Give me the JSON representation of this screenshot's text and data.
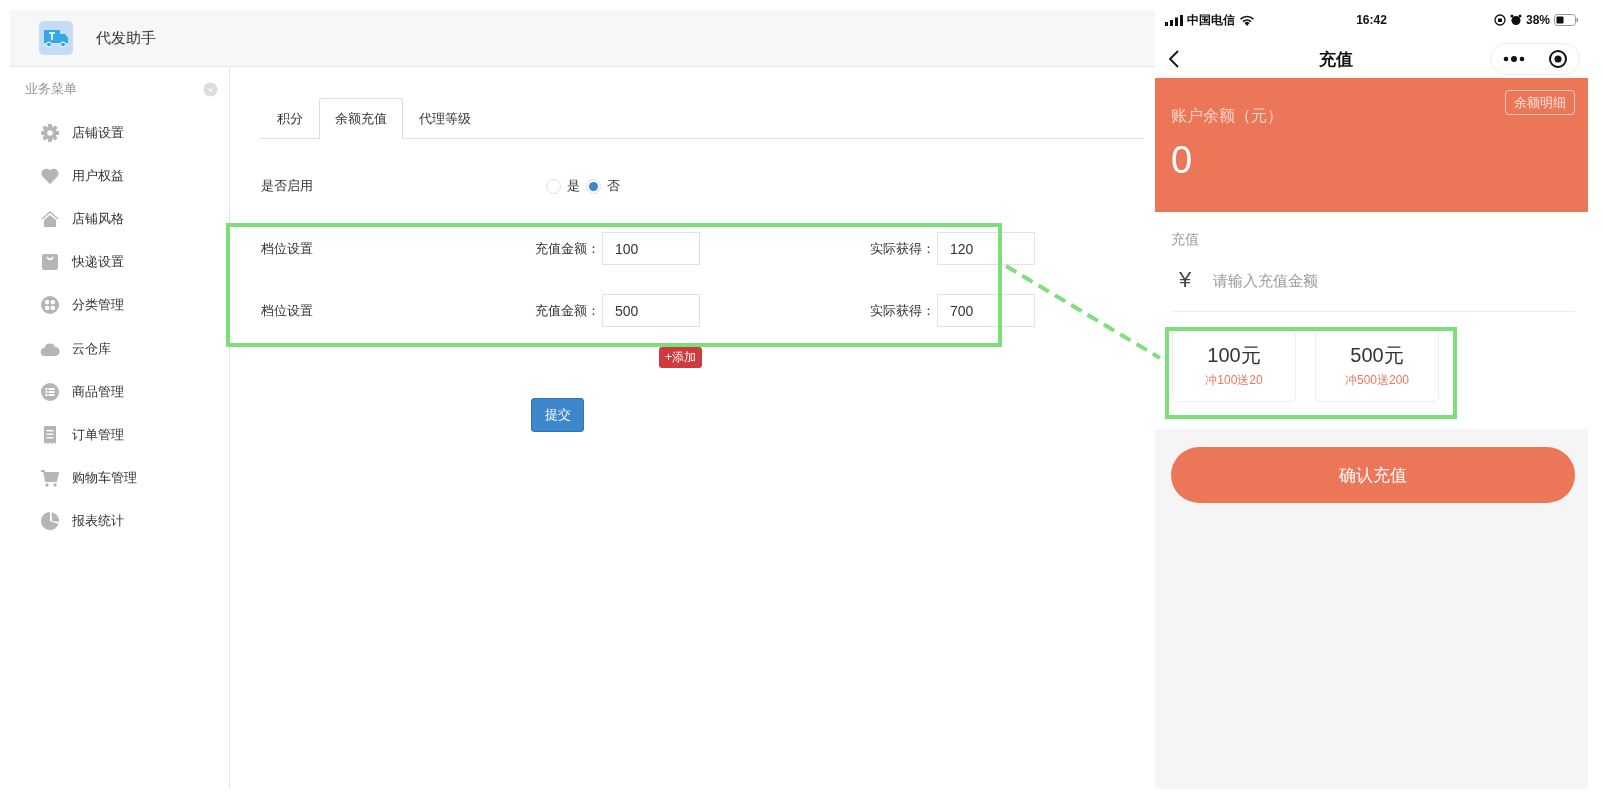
{
  "app": {
    "title": "代发助手"
  },
  "sidebar": {
    "heading": "业务菜单",
    "items": [
      {
        "label": "店铺设置"
      },
      {
        "label": "用户权益"
      },
      {
        "label": "店铺风格"
      },
      {
        "label": "快递设置"
      },
      {
        "label": "分类管理"
      },
      {
        "label": "云仓库"
      },
      {
        "label": "商品管理"
      },
      {
        "label": "订单管理"
      },
      {
        "label": "购物车管理"
      },
      {
        "label": "报表统计"
      }
    ]
  },
  "tabs": [
    {
      "label": "积分",
      "selected": false
    },
    {
      "label": "余额充值",
      "selected": true
    },
    {
      "label": "代理等级",
      "selected": false
    }
  ],
  "enable": {
    "label": "是否启用",
    "options": [
      {
        "label": "是",
        "selected": false
      },
      {
        "label": "否",
        "selected": true
      }
    ]
  },
  "tiers": [
    {
      "label": "档位设置",
      "amount_label": "充值金额：",
      "amount": "100",
      "actual_label": "实际获得：",
      "actual": "120"
    },
    {
      "label": "档位设置",
      "amount_label": "充值金额：",
      "amount": "500",
      "actual_label": "实际获得：",
      "actual": "700"
    }
  ],
  "add_button": "+添加",
  "submit_button": "提交",
  "phone": {
    "status_bar": {
      "carrier": "中国电信",
      "time": "16:42",
      "battery": "38%"
    },
    "nav": {
      "title": "充值"
    },
    "balance": {
      "label": "账户余额（元）",
      "value": "0",
      "detail_button": "余额明细"
    },
    "recharge": {
      "label": "充值",
      "currency": "¥",
      "placeholder": "请输入充值金额",
      "presets": [
        {
          "amount": "100元",
          "bonus": "冲100送20"
        },
        {
          "amount": "500元",
          "bonus": "冲500送200"
        }
      ]
    },
    "confirm_button": "确认充值"
  }
}
